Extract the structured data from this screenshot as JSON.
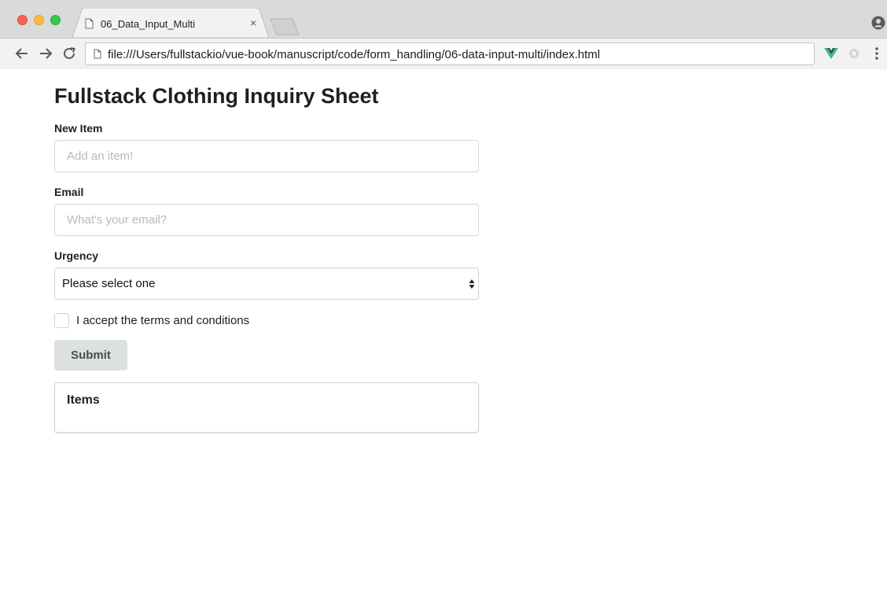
{
  "browser": {
    "tab_title": "06_Data_Input_Multi",
    "tab_close": "×",
    "url": "file:///Users/fullstackio/vue-book/manuscript/code/form_handling/06-data-input-multi/index.html",
    "icons": {
      "back": "back-arrow-icon",
      "forward": "forward-arrow-icon",
      "reload": "reload-icon",
      "page": "document-icon",
      "profile": "profile-icon",
      "vue_ext": "vue-devtools-icon",
      "ext2": "extension-icon",
      "menu": "kebab-menu-icon"
    }
  },
  "page": {
    "heading": "Fullstack Clothing Inquiry Sheet",
    "new_item": {
      "label": "New Item",
      "placeholder": "Add an item!"
    },
    "email": {
      "label": "Email",
      "placeholder": "What's your email?"
    },
    "urgency": {
      "label": "Urgency",
      "selected": "Please select one"
    },
    "terms": {
      "label": "I accept the terms and conditions",
      "checked": false
    },
    "submit_label": "Submit",
    "items_card": {
      "title": "Items"
    }
  },
  "colors": {
    "traffic_red": "#fc605b",
    "traffic_yellow": "#fdbc40",
    "traffic_green": "#34c84a",
    "vue_green": "#41b883",
    "submit_bg": "#dde0e1"
  }
}
